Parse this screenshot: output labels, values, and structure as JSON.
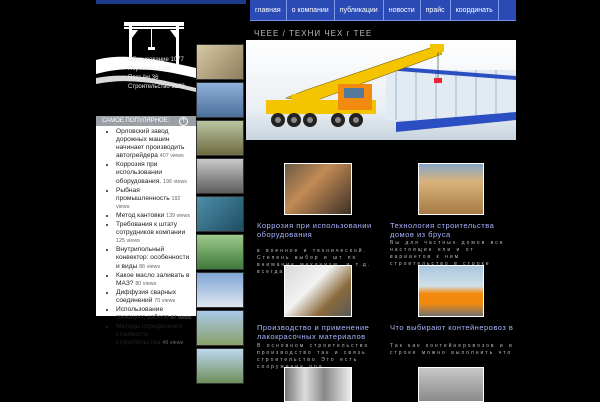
{
  "nav": {
    "items": [
      "главная",
      "о компании",
      "публикации",
      "новости",
      "прайс",
      "координать"
    ]
  },
  "hero": {
    "title": "ЧЕЕЕ / ТЕХНИ       ЧЕХ     г    ТЕЕ"
  },
  "sidebar": {
    "top_list": [
      "Оборудование 1077",
      "Персонал 1188",
      "Подъём 36",
      "Строительство 1263"
    ],
    "popular_header": "САМОЕ ПОПУЛЯРНОЕ:",
    "popular": [
      {
        "title": "Орловский завод дорожных машин начинает производить автогрейдера",
        "views": "407 views"
      },
      {
        "title": "Коррозия при использовании оборудования.",
        "views": "196 views"
      },
      {
        "title": "Рыбная промышленность",
        "views": "192 views"
      },
      {
        "title": "Метод кантовки",
        "views": "139 views"
      },
      {
        "title": "Требования к штату сотрудников компании",
        "views": "125 views"
      },
      {
        "title": "Внутрипольный конвектор: особенности и виды",
        "views": "86 views"
      },
      {
        "title": "Какое масло заливать в МАЗ?",
        "views": "80 views"
      },
      {
        "title": "Диффузия сварных соединений",
        "views": "70 views"
      },
      {
        "title": "Использование греющего кабеля",
        "views": "67 views"
      },
      {
        "title": "Методы определения стоимости строительства",
        "views": "49 views"
      }
    ]
  },
  "posts": [
    {
      "title": "Коррозия при использовании оборудования",
      "excerpt": "в военное и технической. Степень выбор и шт по внимание механизм, и т.д. всегда"
    },
    {
      "title": "Технология строительства домов из бруса",
      "excerpt": "Вы для частных домов все настоящие ели и от вариантов к ним строительство в строке"
    },
    {
      "title": "Производство и применение лакокрасочных материалов",
      "excerpt": "В основном строительство производство так и связь строительство Это есть сооружение при"
    },
    {
      "title": "Что выбирают контейнеровоз в",
      "excerpt": "Так как контейнеровозов и в строке можно выполнить что"
    }
  ],
  "colors": {
    "nav_bg": "#2a4bb5",
    "link": "#aab6ff",
    "crane_yellow": "#f5c400",
    "truck_orange": "#f28a10"
  }
}
